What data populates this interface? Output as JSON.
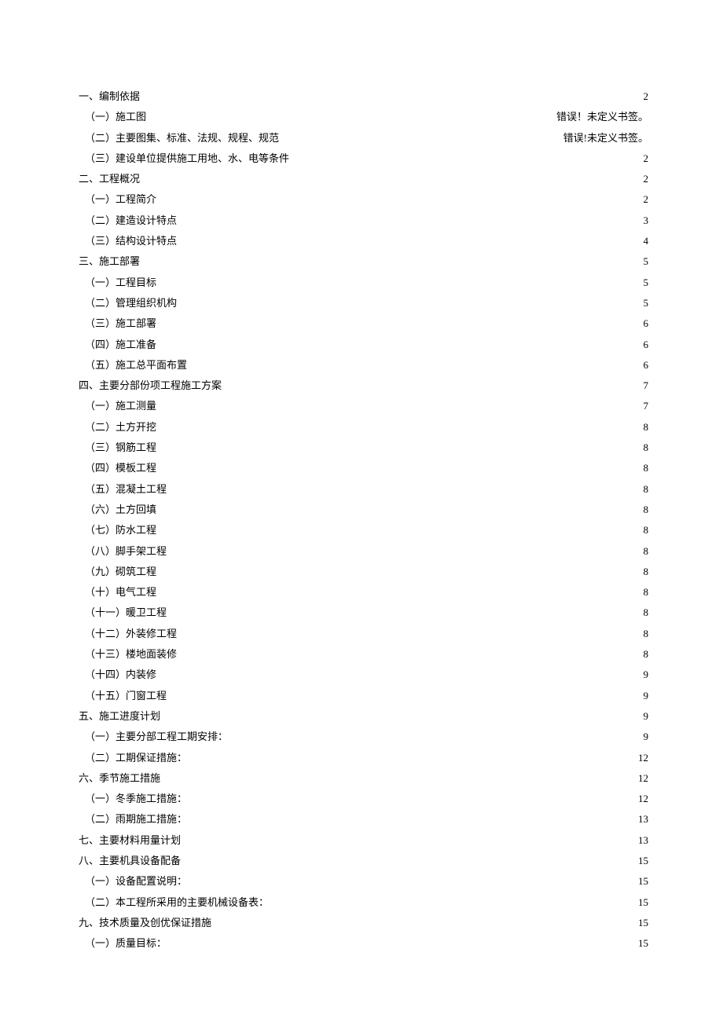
{
  "toc": [
    {
      "label": "一、编制依据",
      "page": "2",
      "sub": false
    },
    {
      "label": "（一）施工图 ",
      "page": " 错误！未定义书签。",
      "sub": true
    },
    {
      "label": "（二）主要图集、标准、法规、规程、规范 ",
      "page": " 错误!未定义书签。",
      "sub": true
    },
    {
      "label": "（三）建设单位提供施工用地、水、电等条件",
      "page": "2",
      "sub": true
    },
    {
      "label": "二、工程概况",
      "page": "2",
      "sub": false
    },
    {
      "label": "（一）工程简介",
      "page": "2",
      "sub": true
    },
    {
      "label": "（二）建造设计特点",
      "page": "3",
      "sub": true
    },
    {
      "label": "（三）结构设计特点",
      "page": "4",
      "sub": true
    },
    {
      "label": "三、施工部署",
      "page": "5",
      "sub": false
    },
    {
      "label": "（一）工程目标",
      "page": "5",
      "sub": true
    },
    {
      "label": "（二）管理组织机构",
      "page": "5",
      "sub": true
    },
    {
      "label": "（三）施工部署",
      "page": "6",
      "sub": true
    },
    {
      "label": "（四）施工准备",
      "page": "6",
      "sub": true
    },
    {
      "label": "（五）施工总平面布置",
      "page": "6",
      "sub": true
    },
    {
      "label": "四、主要分部份项工程施工方案",
      "page": "7",
      "sub": false
    },
    {
      "label": "（一）施工测量",
      "page": "7",
      "sub": true
    },
    {
      "label": "（二）土方开挖",
      "page": "8",
      "sub": true
    },
    {
      "label": "（三）钢筋工程",
      "page": "8",
      "sub": true
    },
    {
      "label": "（四）模板工程",
      "page": "8",
      "sub": true
    },
    {
      "label": "（五）混凝土工程",
      "page": "8",
      "sub": true
    },
    {
      "label": "（六）土方回填",
      "page": "8",
      "sub": true
    },
    {
      "label": "（七）防水工程",
      "page": "8",
      "sub": true
    },
    {
      "label": "（八）脚手架工程",
      "page": "8",
      "sub": true
    },
    {
      "label": "（九）砌筑工程",
      "page": "8",
      "sub": true
    },
    {
      "label": "（十）电气工程",
      "page": "8",
      "sub": true
    },
    {
      "label": "（十一）暖卫工程",
      "page": "8",
      "sub": true
    },
    {
      "label": "（十二）外装修工程",
      "page": "8",
      "sub": true
    },
    {
      "label": "（十三）楼地面装修",
      "page": "8",
      "sub": true
    },
    {
      "label": "（十四）内装修",
      "page": "9",
      "sub": true
    },
    {
      "label": "（十五）门窗工程",
      "page": "9",
      "sub": true
    },
    {
      "label": "五、施工进度计划",
      "page": "9",
      "sub": false
    },
    {
      "label": "（一）主要分部工程工期安排：",
      "page": "9",
      "sub": true
    },
    {
      "label": "（二）工期保证措施：",
      "page": "12",
      "sub": true
    },
    {
      "label": "六、季节施工措施",
      "page": "12",
      "sub": false
    },
    {
      "label": "（一）冬季施工措施：",
      "page": "12",
      "sub": true
    },
    {
      "label": "（二）雨期施工措施：",
      "page": "13",
      "sub": true
    },
    {
      "label": "七、主要材料用量计划",
      "page": "13",
      "sub": false
    },
    {
      "label": "八、主要机具设备配备",
      "page": "15",
      "sub": false
    },
    {
      "label": "（一）设备配置说明：",
      "page": "15",
      "sub": true
    },
    {
      "label": "（二）本工程所采用的主要机械设备表：",
      "page": "15",
      "sub": true
    },
    {
      "label": "九、技术质量及创优保证措施",
      "page": "15",
      "sub": false
    },
    {
      "label": "（一）质量目标：",
      "page": "15",
      "sub": true
    }
  ]
}
